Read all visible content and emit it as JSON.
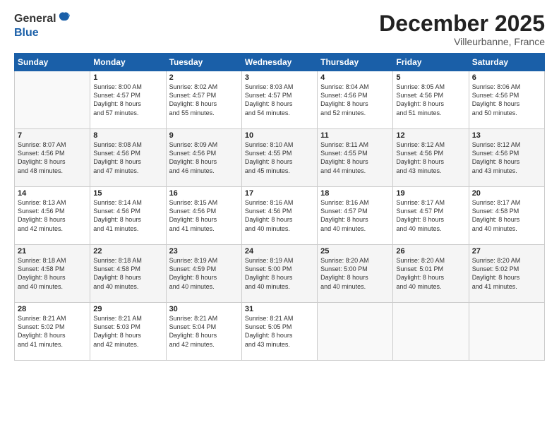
{
  "header": {
    "logo_line1": "General",
    "logo_line2": "Blue",
    "month": "December 2025",
    "location": "Villeurbanne, France"
  },
  "days_of_week": [
    "Sunday",
    "Monday",
    "Tuesday",
    "Wednesday",
    "Thursday",
    "Friday",
    "Saturday"
  ],
  "weeks": [
    [
      {
        "day": "",
        "info": ""
      },
      {
        "day": "1",
        "info": "Sunrise: 8:00 AM\nSunset: 4:57 PM\nDaylight: 8 hours\nand 57 minutes."
      },
      {
        "day": "2",
        "info": "Sunrise: 8:02 AM\nSunset: 4:57 PM\nDaylight: 8 hours\nand 55 minutes."
      },
      {
        "day": "3",
        "info": "Sunrise: 8:03 AM\nSunset: 4:57 PM\nDaylight: 8 hours\nand 54 minutes."
      },
      {
        "day": "4",
        "info": "Sunrise: 8:04 AM\nSunset: 4:56 PM\nDaylight: 8 hours\nand 52 minutes."
      },
      {
        "day": "5",
        "info": "Sunrise: 8:05 AM\nSunset: 4:56 PM\nDaylight: 8 hours\nand 51 minutes."
      },
      {
        "day": "6",
        "info": "Sunrise: 8:06 AM\nSunset: 4:56 PM\nDaylight: 8 hours\nand 50 minutes."
      }
    ],
    [
      {
        "day": "7",
        "info": "Sunrise: 8:07 AM\nSunset: 4:56 PM\nDaylight: 8 hours\nand 48 minutes."
      },
      {
        "day": "8",
        "info": "Sunrise: 8:08 AM\nSunset: 4:56 PM\nDaylight: 8 hours\nand 47 minutes."
      },
      {
        "day": "9",
        "info": "Sunrise: 8:09 AM\nSunset: 4:56 PM\nDaylight: 8 hours\nand 46 minutes."
      },
      {
        "day": "10",
        "info": "Sunrise: 8:10 AM\nSunset: 4:55 PM\nDaylight: 8 hours\nand 45 minutes."
      },
      {
        "day": "11",
        "info": "Sunrise: 8:11 AM\nSunset: 4:55 PM\nDaylight: 8 hours\nand 44 minutes."
      },
      {
        "day": "12",
        "info": "Sunrise: 8:12 AM\nSunset: 4:56 PM\nDaylight: 8 hours\nand 43 minutes."
      },
      {
        "day": "13",
        "info": "Sunrise: 8:12 AM\nSunset: 4:56 PM\nDaylight: 8 hours\nand 43 minutes."
      }
    ],
    [
      {
        "day": "14",
        "info": "Sunrise: 8:13 AM\nSunset: 4:56 PM\nDaylight: 8 hours\nand 42 minutes."
      },
      {
        "day": "15",
        "info": "Sunrise: 8:14 AM\nSunset: 4:56 PM\nDaylight: 8 hours\nand 41 minutes."
      },
      {
        "day": "16",
        "info": "Sunrise: 8:15 AM\nSunset: 4:56 PM\nDaylight: 8 hours\nand 41 minutes."
      },
      {
        "day": "17",
        "info": "Sunrise: 8:16 AM\nSunset: 4:56 PM\nDaylight: 8 hours\nand 40 minutes."
      },
      {
        "day": "18",
        "info": "Sunrise: 8:16 AM\nSunset: 4:57 PM\nDaylight: 8 hours\nand 40 minutes."
      },
      {
        "day": "19",
        "info": "Sunrise: 8:17 AM\nSunset: 4:57 PM\nDaylight: 8 hours\nand 40 minutes."
      },
      {
        "day": "20",
        "info": "Sunrise: 8:17 AM\nSunset: 4:58 PM\nDaylight: 8 hours\nand 40 minutes."
      }
    ],
    [
      {
        "day": "21",
        "info": "Sunrise: 8:18 AM\nSunset: 4:58 PM\nDaylight: 8 hours\nand 40 minutes."
      },
      {
        "day": "22",
        "info": "Sunrise: 8:18 AM\nSunset: 4:58 PM\nDaylight: 8 hours\nand 40 minutes."
      },
      {
        "day": "23",
        "info": "Sunrise: 8:19 AM\nSunset: 4:59 PM\nDaylight: 8 hours\nand 40 minutes."
      },
      {
        "day": "24",
        "info": "Sunrise: 8:19 AM\nSunset: 5:00 PM\nDaylight: 8 hours\nand 40 minutes."
      },
      {
        "day": "25",
        "info": "Sunrise: 8:20 AM\nSunset: 5:00 PM\nDaylight: 8 hours\nand 40 minutes."
      },
      {
        "day": "26",
        "info": "Sunrise: 8:20 AM\nSunset: 5:01 PM\nDaylight: 8 hours\nand 40 minutes."
      },
      {
        "day": "27",
        "info": "Sunrise: 8:20 AM\nSunset: 5:02 PM\nDaylight: 8 hours\nand 41 minutes."
      }
    ],
    [
      {
        "day": "28",
        "info": "Sunrise: 8:21 AM\nSunset: 5:02 PM\nDaylight: 8 hours\nand 41 minutes."
      },
      {
        "day": "29",
        "info": "Sunrise: 8:21 AM\nSunset: 5:03 PM\nDaylight: 8 hours\nand 42 minutes."
      },
      {
        "day": "30",
        "info": "Sunrise: 8:21 AM\nSunset: 5:04 PM\nDaylight: 8 hours\nand 42 minutes."
      },
      {
        "day": "31",
        "info": "Sunrise: 8:21 AM\nSunset: 5:05 PM\nDaylight: 8 hours\nand 43 minutes."
      },
      {
        "day": "",
        "info": ""
      },
      {
        "day": "",
        "info": ""
      },
      {
        "day": "",
        "info": ""
      }
    ]
  ]
}
